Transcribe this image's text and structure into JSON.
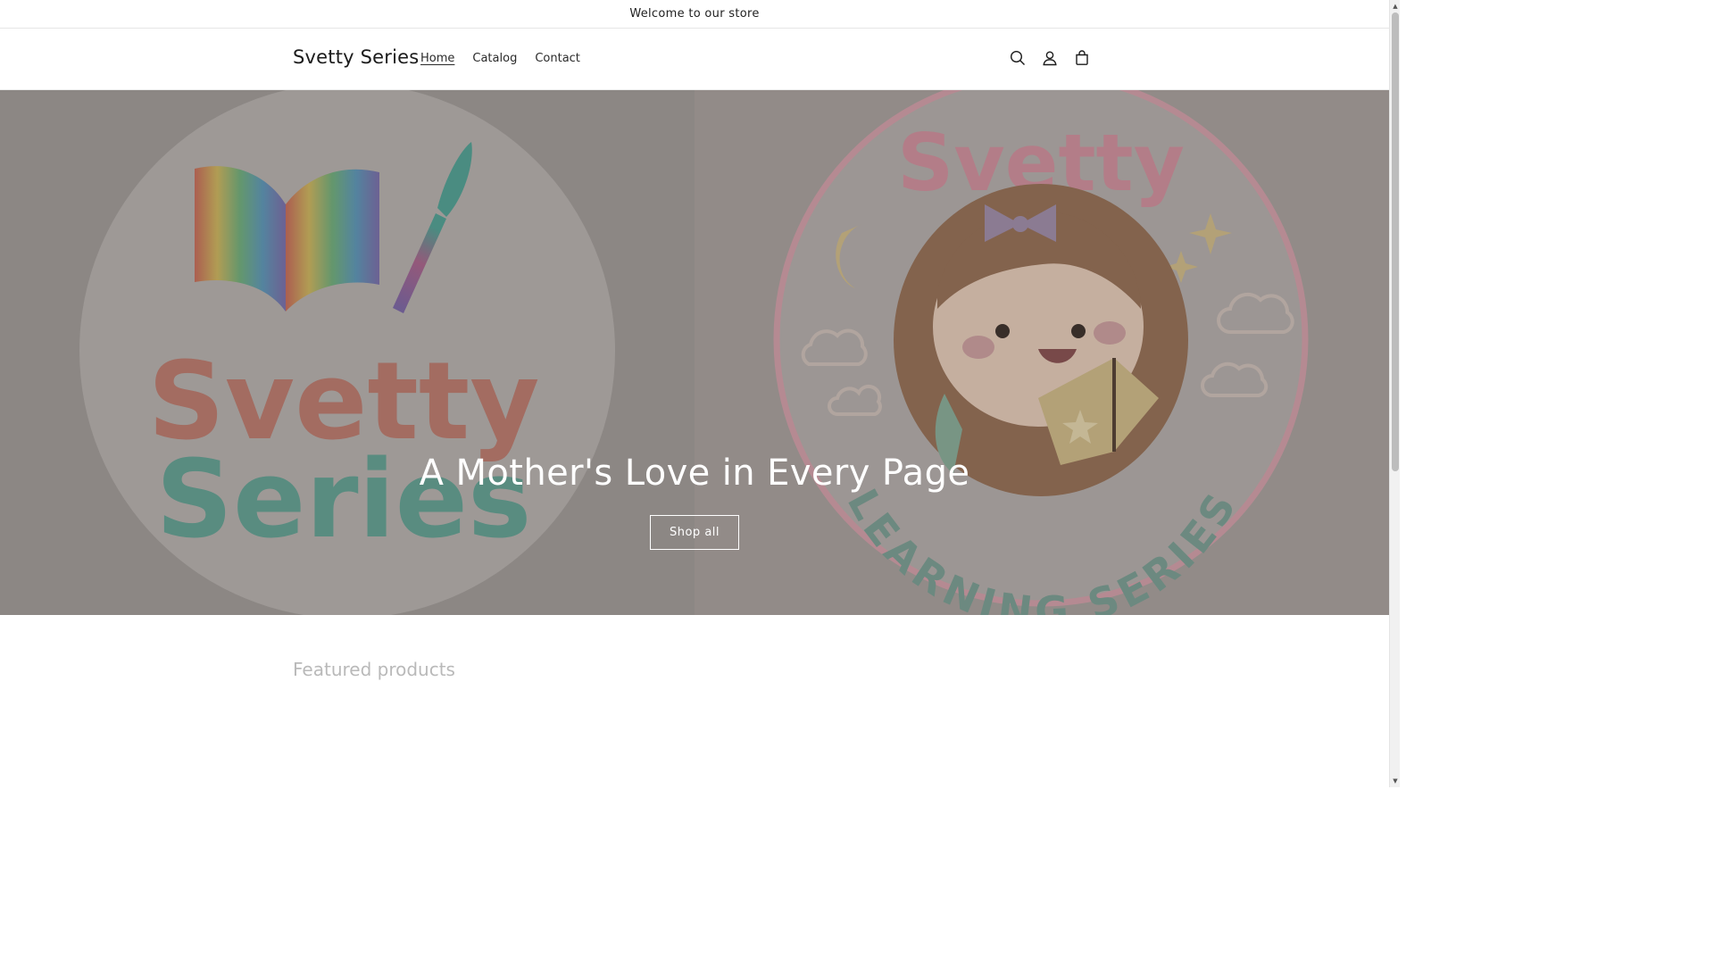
{
  "announcement": {
    "text": "Welcome to our store"
  },
  "header": {
    "logo": "Svetty Series",
    "nav": [
      {
        "label": "Home",
        "active": true
      },
      {
        "label": "Catalog",
        "active": false
      },
      {
        "label": "Contact",
        "active": false
      }
    ],
    "icons": [
      "search-icon",
      "account-icon",
      "cart-icon"
    ]
  },
  "hero": {
    "title": "A Mother's Love in Every Page",
    "button": "Shop all",
    "left_image": {
      "logo_text": "Svetty Series"
    },
    "right_image": {
      "logo_top": "Svetty",
      "logo_bottom": "LEARNING SERIES"
    }
  },
  "featured": {
    "title": "Featured products"
  },
  "colors": {
    "accent_text": "#121212",
    "hero_overlay_text": "#ffffff",
    "featured_title": "#b9b9b9"
  }
}
